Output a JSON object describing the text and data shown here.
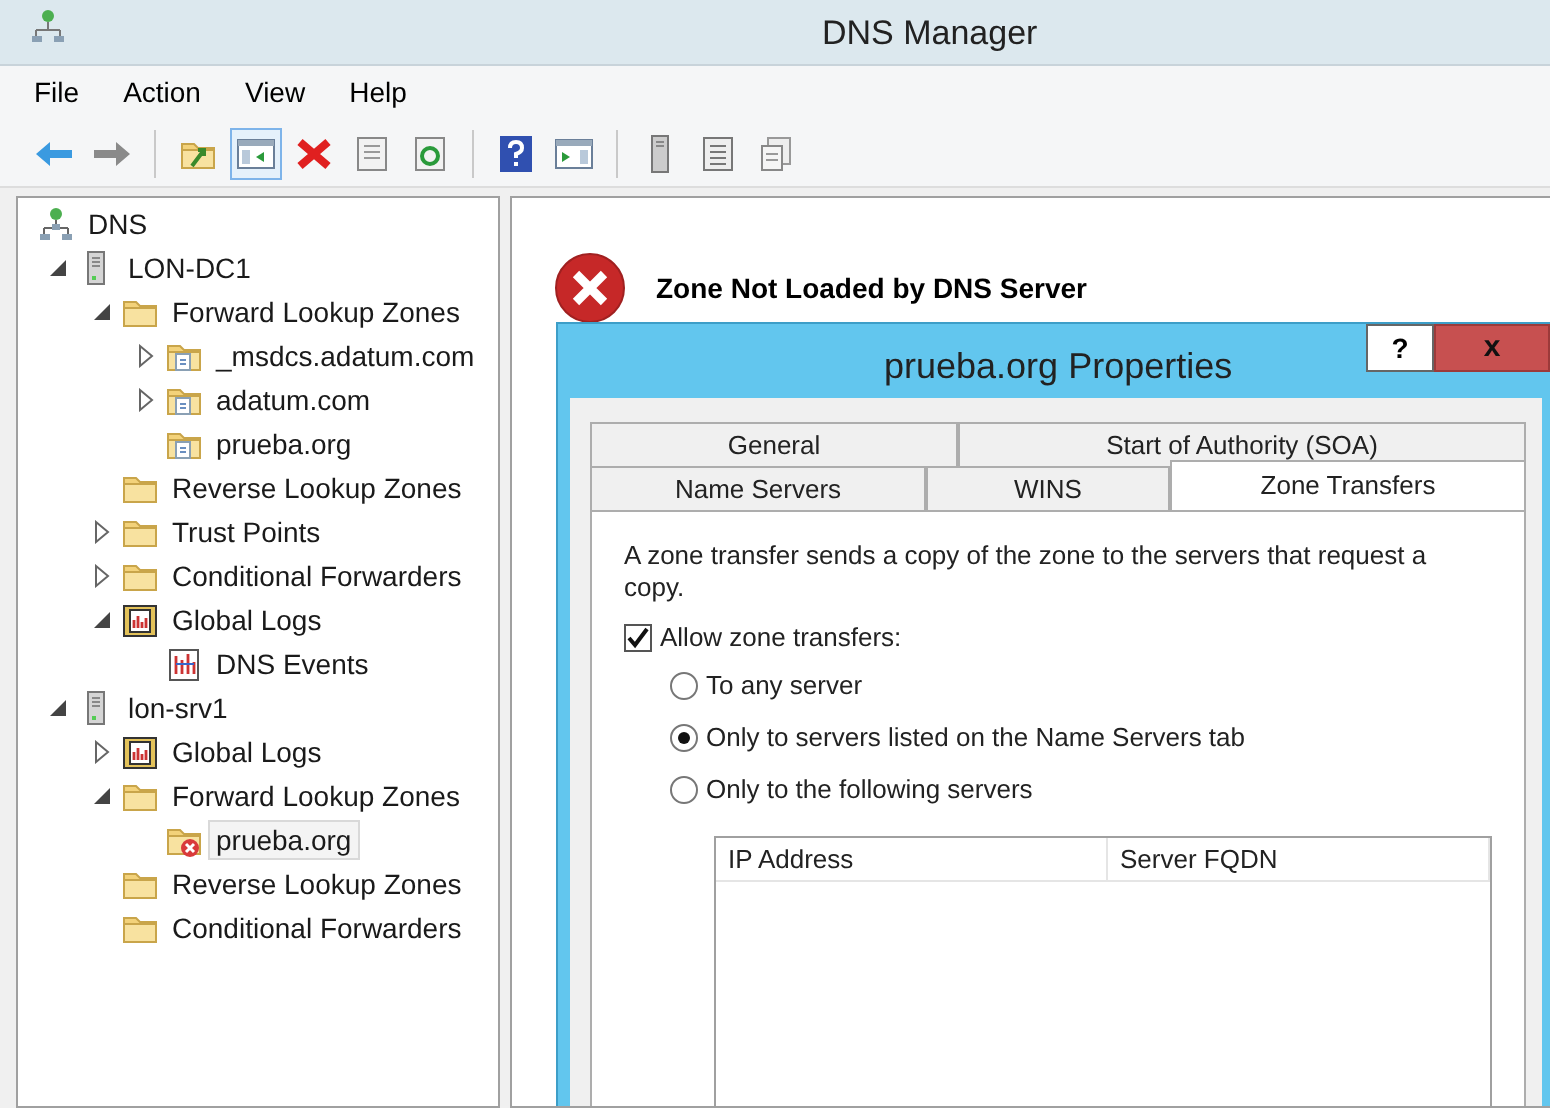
{
  "window": {
    "title": "DNS Manager"
  },
  "menu": [
    "File",
    "Action",
    "View",
    "Help"
  ],
  "toolbar": [
    [
      {
        "kind": "back",
        "pressed": false
      },
      {
        "kind": "forward",
        "pressed": false
      }
    ],
    [
      {
        "kind": "up",
        "pressed": false
      },
      {
        "kind": "tree",
        "pressed": true
      },
      {
        "kind": "delete",
        "pressed": false
      },
      {
        "kind": "properties",
        "pressed": false
      },
      {
        "kind": "refresh",
        "pressed": false
      }
    ],
    [
      {
        "kind": "help",
        "pressed": false
      },
      {
        "kind": "action-pane",
        "pressed": false
      }
    ],
    [
      {
        "kind": "server",
        "pressed": false
      },
      {
        "kind": "list",
        "pressed": false
      },
      {
        "kind": "export",
        "pressed": false
      }
    ]
  ],
  "tree": [
    {
      "label": "DNS",
      "kind": "dns",
      "selected": false,
      "children": [
        {
          "label": "LON-DC1",
          "kind": "server",
          "expanded": true,
          "selected": false,
          "children": [
            {
              "label": "Forward Lookup Zones",
              "kind": "folder",
              "expanded": true,
              "selected": false,
              "children": [
                {
                  "label": "_msdcs.adatum.com",
                  "kind": "zone",
                  "expanded": false,
                  "selected": false
                },
                {
                  "label": "adatum.com",
                  "kind": "zone",
                  "expanded": false,
                  "selected": false
                },
                {
                  "label": "prueba.org",
                  "kind": "zone",
                  "selected": false
                }
              ]
            },
            {
              "label": "Reverse Lookup Zones",
              "kind": "folder",
              "selected": false
            },
            {
              "label": "Trust Points",
              "kind": "folder",
              "expanded": false,
              "selected": false
            },
            {
              "label": "Conditional Forwarders",
              "kind": "folder",
              "expanded": false,
              "selected": false
            },
            {
              "label": "Global Logs",
              "kind": "logs",
              "expanded": true,
              "selected": false,
              "children": [
                {
                  "label": "DNS Events",
                  "kind": "events",
                  "selected": false
                }
              ]
            }
          ]
        },
        {
          "label": "lon-srv1",
          "kind": "server",
          "expanded": true,
          "selected": false,
          "children": [
            {
              "label": "Global Logs",
              "kind": "logs",
              "expanded": false,
              "selected": false
            },
            {
              "label": "Forward Lookup Zones",
              "kind": "folder",
              "expanded": true,
              "selected": false,
              "children": [
                {
                  "label": "prueba.org",
                  "kind": "zone-error",
                  "selected": true
                }
              ]
            },
            {
              "label": "Reverse Lookup Zones",
              "kind": "folder",
              "selected": false
            },
            {
              "label": "Conditional Forwarders",
              "kind": "folder",
              "selected": false
            }
          ]
        }
      ]
    }
  ],
  "details": {
    "heading": "Zone Not Loaded by DNS Server"
  },
  "dialog": {
    "title": "prueba.org Properties",
    "help_button": "?",
    "close_button": "x",
    "tab_rows": [
      [
        {
          "label": "General",
          "selected": false
        },
        {
          "label": "Start of Authority (SOA)",
          "selected": false
        }
      ],
      [
        {
          "label": "Name Servers",
          "selected": false
        },
        {
          "label": "WINS",
          "selected": false
        },
        {
          "label": "Zone Transfers",
          "selected": true
        }
      ]
    ],
    "description": "A zone transfer sends a copy of the zone to the servers that request a copy.",
    "allow_transfers": {
      "label": "Allow zone transfers:",
      "checked": true
    },
    "options": [
      {
        "label": "To any server",
        "selected": false
      },
      {
        "label": "Only to servers listed on the Name Servers tab",
        "selected": true
      },
      {
        "label": "Only to the following servers",
        "selected": false
      }
    ],
    "server_list": {
      "columns": [
        "IP Address",
        "Server FQDN"
      ]
    }
  }
}
